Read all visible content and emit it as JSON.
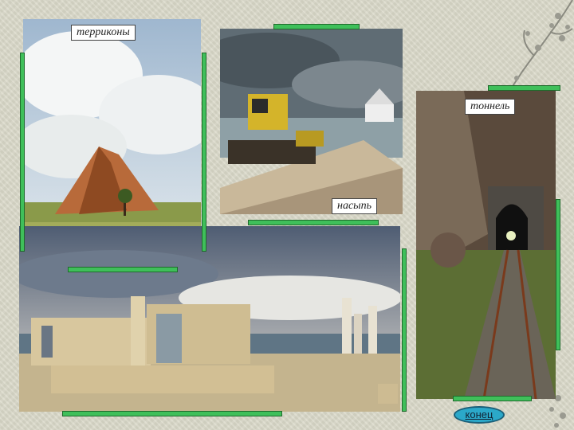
{
  "slide": {
    "labels": {
      "terrikony": "терриконы",
      "tonnel": "тоннель",
      "nasyp": "насыпь"
    },
    "end_button": "конец"
  },
  "colors": {
    "accent_bar": "#3fbf5a",
    "end_button": "#2ba8c9",
    "background": "#d9d8c8"
  }
}
